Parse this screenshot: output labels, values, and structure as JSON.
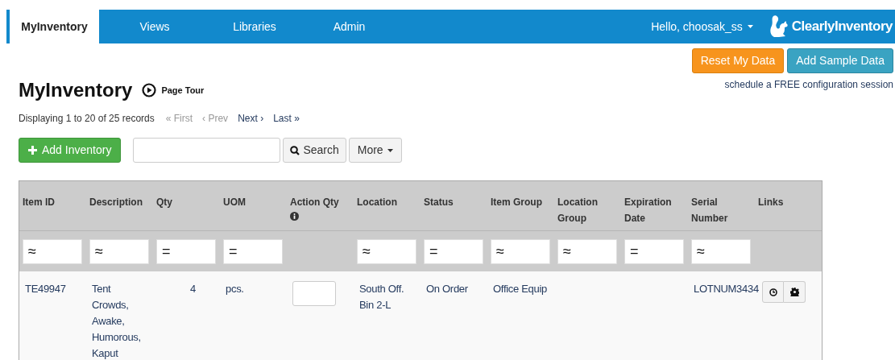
{
  "nav": {
    "tabs": [
      {
        "label": "MyInventory",
        "selected": true
      },
      {
        "label": "Views",
        "selected": false
      },
      {
        "label": "Libraries",
        "selected": false
      },
      {
        "label": "Admin",
        "selected": false
      }
    ],
    "user_menu": "Hello, choosak_ss",
    "logo": "ClearlyInventory"
  },
  "top_buttons": [
    {
      "label": "Reset My Data",
      "kind": "warning"
    },
    {
      "label": "Add Sample Data",
      "kind": "info"
    }
  ],
  "config_link": "schedule a FREE configuration session",
  "page_title": "MyInventory",
  "page_tour": "Page Tour",
  "pager": {
    "summary": "Displaying 1 to 20 of 25 records",
    "links": [
      {
        "label": "« First",
        "disabled": true
      },
      {
        "label": "‹ Prev",
        "disabled": true
      },
      {
        "label": "Next ›",
        "disabled": false
      },
      {
        "label": "Last »",
        "disabled": false
      }
    ]
  },
  "toolbar": {
    "add_button": "Add Inventory",
    "search_button": "Search",
    "more_button": "More"
  },
  "table": {
    "columns": [
      {
        "label": "Item ID",
        "filter": "≈"
      },
      {
        "label": "Description",
        "filter": "≈"
      },
      {
        "label": "Qty",
        "filter": "="
      },
      {
        "label": "UOM",
        "filter": "="
      },
      {
        "label": "Action Qty",
        "info": true
      },
      {
        "label": "Location",
        "filter": "≈"
      },
      {
        "label": "Status",
        "filter": "="
      },
      {
        "label": "Item Group",
        "filter": "≈"
      },
      {
        "label": "Location Group",
        "filter": "≈"
      },
      {
        "label": "Expiration Date",
        "filter": "="
      },
      {
        "label": "Serial Number",
        "filter": "≈"
      },
      {
        "label": "Links"
      }
    ],
    "rows": [
      {
        "cells": [
          {
            "kind": "text",
            "text": "TE49947"
          },
          {
            "kind": "text",
            "text": "Tent Crowds, Awake, Humorous, Kaput"
          },
          {
            "kind": "number",
            "text": "4"
          },
          {
            "kind": "text",
            "text": "pcs."
          },
          {
            "kind": "input"
          },
          {
            "kind": "text",
            "text": "South Off. Bin 2-L"
          },
          {
            "kind": "text",
            "text": "On Order"
          },
          {
            "kind": "text",
            "text": "Office Equip"
          },
          {
            "kind": "empty"
          },
          {
            "kind": "empty"
          },
          {
            "kind": "text",
            "text": "LOTNUM3434"
          },
          {
            "kind": "links"
          }
        ]
      }
    ]
  }
}
